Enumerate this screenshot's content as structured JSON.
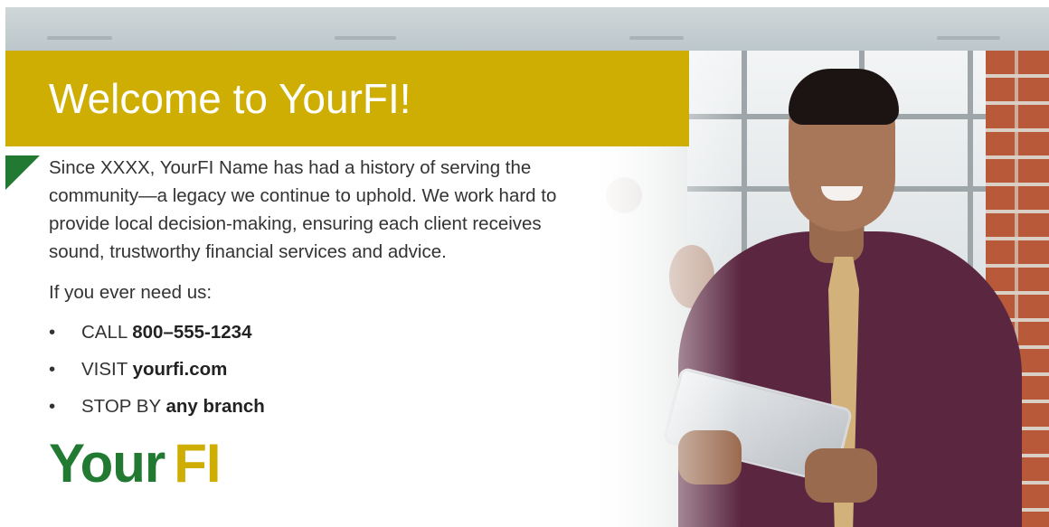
{
  "banner": {
    "title": "Welcome to YourFI!"
  },
  "intro": "Since XXXX, YourFI Name has had a history of serving the community—a legacy we continue to uphold. We work hard to provide local decision-making, ensuring each client receives sound, trustworthy financial services and advice.",
  "need_text": "If you ever need us:",
  "contacts": [
    {
      "bullet": "•",
      "label": "CALL",
      "value": "800–555-1234"
    },
    {
      "bullet": "•",
      "label": "VISIT",
      "value": "yourfi.com"
    },
    {
      "bullet": "•",
      "label": "STOP BY",
      "value": "any branch"
    }
  ],
  "logo": {
    "part1": "Your",
    "part2": "FI"
  },
  "colors": {
    "brand_gold": "#cfae04",
    "brand_green": "#227a32",
    "text": "#333333"
  }
}
